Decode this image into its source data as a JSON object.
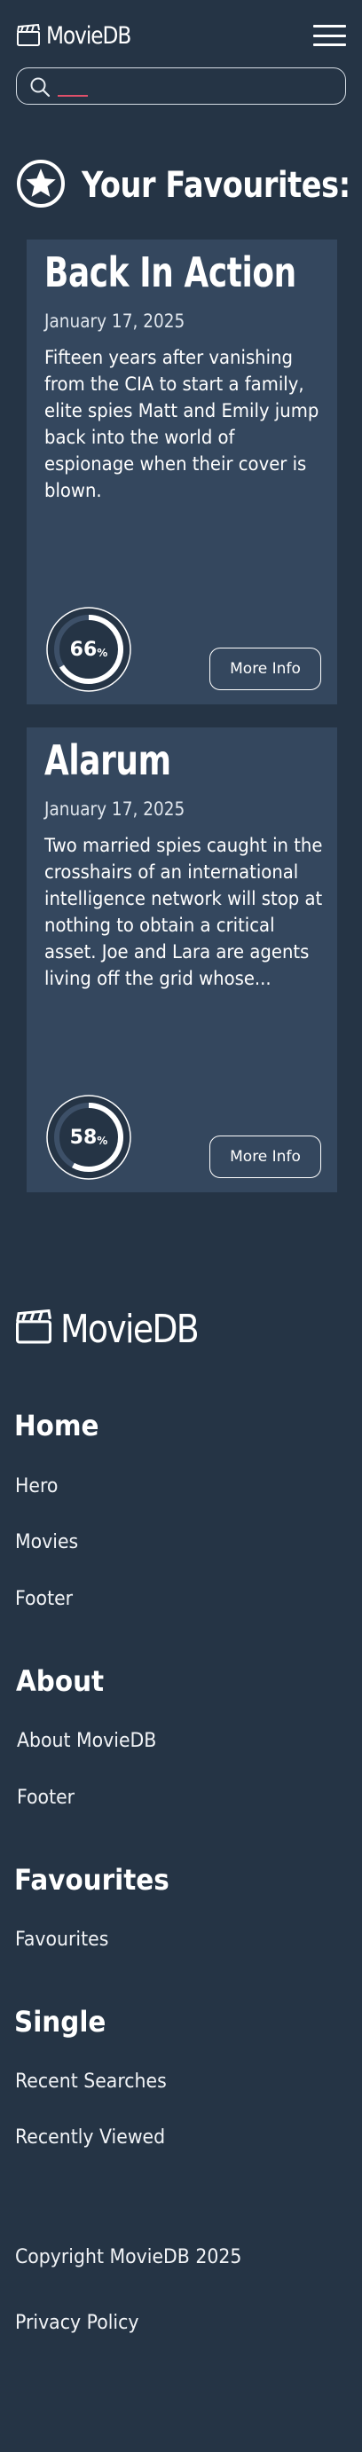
{
  "header": {
    "logo_text": "MovieDB",
    "search_placeholder": ""
  },
  "favourites": {
    "heading": "Your Favourites:",
    "cards": [
      {
        "title": "Back In Action",
        "date": "January 17, 2025",
        "overview": "Fifteen years after vanishing from the CIA to start a family, elite spies Matt and Emily jump back into the world of espionage when their cover is blown.",
        "rating": 66,
        "pct_symbol": "%",
        "button_label": "More Info"
      },
      {
        "title": "Alarum",
        "date": "January 17, 2025",
        "overview": "Two married spies caught in the crosshairs of an international intelligence network will stop at nothing to obtain a critical asset. Joe and Lara are agents living off the grid whose...",
        "rating": 58,
        "pct_symbol": "%",
        "button_label": "More Info"
      }
    ]
  },
  "footer": {
    "logo_text": "MovieDB",
    "sections": [
      {
        "heading": "Home",
        "links": [
          "Hero",
          "Movies",
          "Footer"
        ]
      },
      {
        "heading": "About",
        "links": [
          "About MovieDB",
          "Footer"
        ]
      },
      {
        "heading": "Favourites",
        "links": [
          "Favourites"
        ]
      },
      {
        "heading": "Single",
        "links": [
          "Recent Searches",
          "Recently Viewed"
        ]
      }
    ],
    "copyright": "Copyright MovieDB 2025",
    "privacy": "Privacy Policy"
  },
  "colors": {
    "background": "#253445",
    "card": "#34475e",
    "caret": "#e0506a",
    "text": "#ffffff"
  },
  "icons": {
    "logo": "clapperboard-icon",
    "menu": "hamburger-menu-icon",
    "search": "search-icon",
    "favourites": "star-circle-icon"
  }
}
